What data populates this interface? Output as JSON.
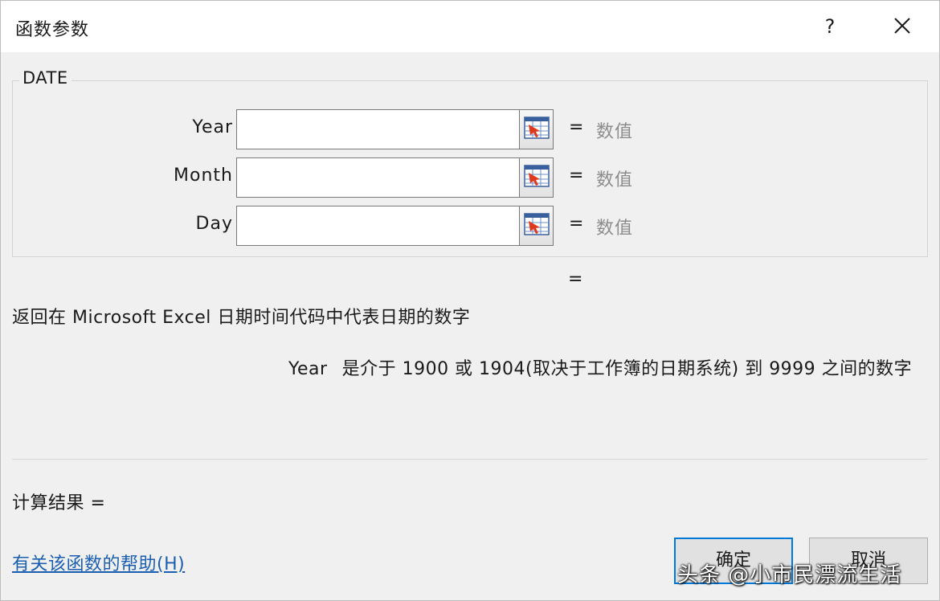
{
  "dialog": {
    "title": "函数参数",
    "help_glyph": "?"
  },
  "function": {
    "name": "DATE",
    "args": [
      {
        "label": "Year",
        "value": "",
        "result_eq": "=",
        "result": "数值"
      },
      {
        "label": "Month",
        "value": "",
        "result_eq": "=",
        "result": "数值"
      },
      {
        "label": "Day",
        "value": "",
        "result_eq": "=",
        "result": "数值"
      }
    ],
    "formula_eq": "=",
    "description": "返回在 Microsoft Excel 日期时间代码中代表日期的数字",
    "arg_desc_name": "Year",
    "arg_desc_text": "是介于 1900 或 1904(取决于工作簿的日期系统) 到 9999 之间的数字"
  },
  "result": {
    "label": "计算结果 ="
  },
  "footer": {
    "help_link": "有关该函数的帮助(H)",
    "ok_label": "确定",
    "cancel_label": "取消"
  },
  "watermark": "头条 @小市民漂流生活",
  "colors": {
    "accent": "#0078d7",
    "link": "#1b5fb0",
    "value_gray": "#8c8c8c",
    "background": "#f0f0f0"
  },
  "icons": {
    "close": "close-icon",
    "help": "help-icon",
    "ref": "range-select-icon"
  }
}
